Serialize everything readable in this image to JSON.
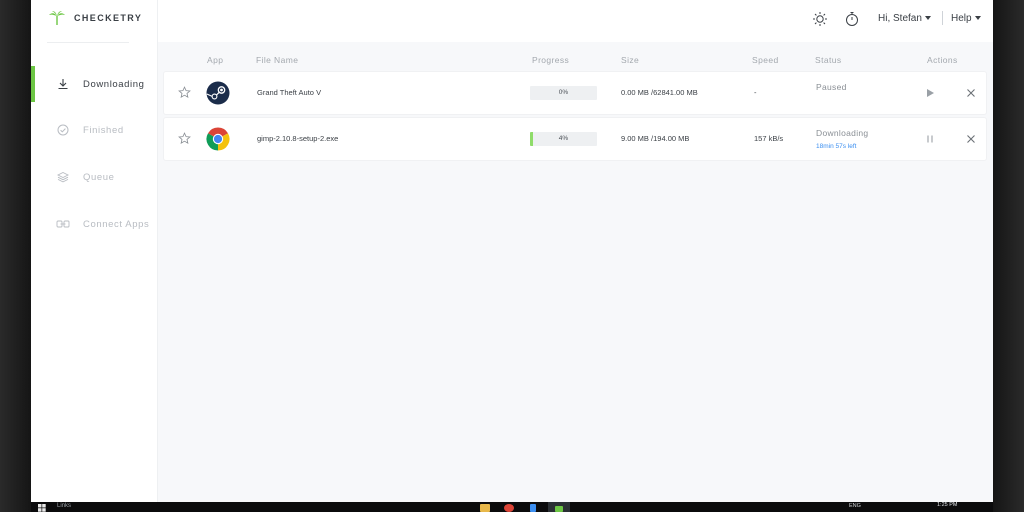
{
  "app": {
    "brand": "CHECKETRY",
    "accent": "#6cc644"
  },
  "sidebar": {
    "items": [
      {
        "label": "Downloading",
        "icon": "download-icon",
        "active": true
      },
      {
        "label": "Finished",
        "icon": "check-circle-icon",
        "active": false
      },
      {
        "label": "Queue",
        "icon": "layers-icon",
        "active": false
      },
      {
        "label": "Connect Apps",
        "icon": "link-icon",
        "active": false
      }
    ]
  },
  "topbar": {
    "theme_icon": "sun-icon",
    "timer_icon": "stopwatch-icon",
    "user_greeting": "Hi, Stefan",
    "help_label": "Help"
  },
  "table": {
    "headers": {
      "app": "App",
      "file_name": "File Name",
      "progress": "Progress",
      "size": "Size",
      "speed": "Speed",
      "status": "Status",
      "actions": "Actions"
    },
    "rows": [
      {
        "app_icon": "steam-icon",
        "file_name": "Grand Theft Auto V",
        "progress": 0,
        "progress_label": "0%",
        "size": "0.00 MB /62841.00 MB",
        "speed": "-",
        "status": "Paused",
        "status_sub": "",
        "primary_action": "play-icon",
        "starred": false
      },
      {
        "app_icon": "chrome-icon",
        "file_name": "gimp-2.10.8-setup-2.exe",
        "progress": 4,
        "progress_label": "4%",
        "size": "9.00 MB /194.00 MB",
        "speed": "157 kB/s",
        "status": "Downloading",
        "status_sub": "18min 57s left",
        "primary_action": "pause-icon",
        "starred": false
      }
    ]
  },
  "taskbar": {
    "search_text": "Links",
    "tray_lang": "ENG",
    "time": "1:25 PM"
  }
}
